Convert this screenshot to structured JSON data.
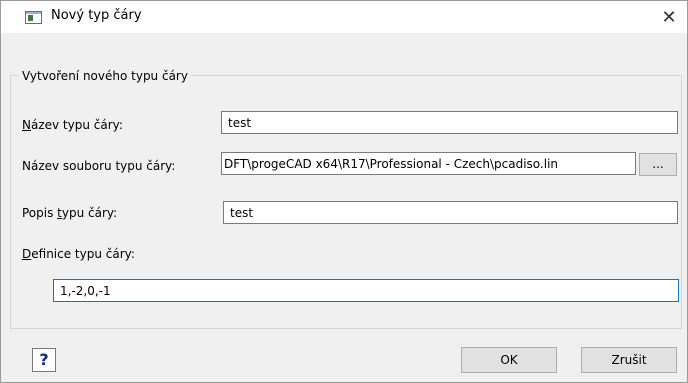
{
  "window": {
    "title": "Nový typ čáry",
    "close_symbol": "✕"
  },
  "group": {
    "legend": "Vytvoření nového typu čáry"
  },
  "fields": {
    "name": {
      "label_mnemonic": "N",
      "label_rest": "ázev typu čáry:",
      "value": "test"
    },
    "file": {
      "label": "Název souboru typu čáry:",
      "value": "DFT\\progeCAD x64\\R17\\Professional - Czech\\pcadiso.lin",
      "browse_label": "...",
      "browse_mnemonic": "."
    },
    "description": {
      "label_before": "Popis ",
      "label_mnemonic": "t",
      "label_after": "ypu čáry:",
      "value": "test"
    },
    "definition": {
      "label_mnemonic": "D",
      "label_rest": "efinice typu čáry:",
      "value": "1,-2,0,-1"
    }
  },
  "buttons": {
    "help": "?",
    "ok": "OK",
    "cancel": "Zrušit"
  },
  "colors": {
    "focus_border": "#0078d7",
    "dialog_bg": "#f0f0f0"
  }
}
